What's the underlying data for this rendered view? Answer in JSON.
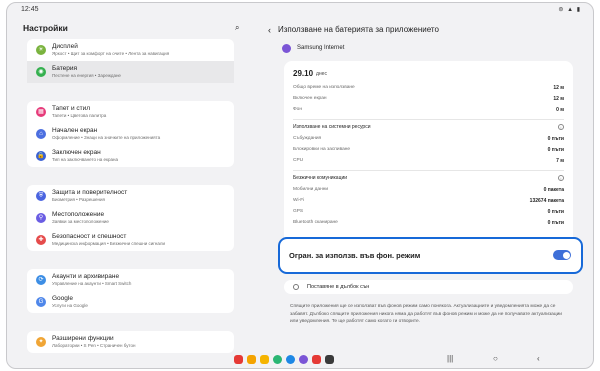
{
  "status": {
    "time": "12:45",
    "system_icons": "⊜ ▲ ▮"
  },
  "left": {
    "title": "Настройки",
    "search_icon": "⌕",
    "groups": [
      [
        {
          "title": "Дисплей",
          "subtitle": "Яркост • Щит за комфорт на очите • Лента за навигация",
          "color": "#7ab33e",
          "glyph": "☀"
        },
        {
          "title": "Батерия",
          "subtitle": "Пестене на енергия • Зареждане",
          "color": "#35b04f",
          "glyph": "◉",
          "selected": true
        }
      ],
      [
        {
          "title": "Тапет и стил",
          "subtitle": "Тапети • Цветова палитра",
          "color": "#e63b7a",
          "glyph": "▦"
        },
        {
          "title": "Начален екран",
          "subtitle": "Оформление • Знаци на значките на приложенията",
          "color": "#4c6fe0",
          "glyph": "⌂"
        },
        {
          "title": "Заключен екран",
          "subtitle": "Тип на заключването на екрана",
          "color": "#3a61d4",
          "glyph": "🔒"
        }
      ],
      [
        {
          "title": "Защита и поверителност",
          "subtitle": "Биометрия • Разрешения",
          "color": "#4a64e0",
          "glyph": "⛨"
        },
        {
          "title": "Местоположение",
          "subtitle": "Заявки за местоположение",
          "color": "#6a5de3",
          "glyph": "⚲"
        },
        {
          "title": "Безопасност и спешност",
          "subtitle": "Медицинска информация • Безжични спешни сигнали",
          "color": "#e54b4b",
          "glyph": "✚"
        }
      ],
      [
        {
          "title": "Акаунти и архивиране",
          "subtitle": "Управление на акаунти • Smart Switch",
          "color": "#3d8ee5",
          "glyph": "⟳"
        },
        {
          "title": "Google",
          "subtitle": "Услуги на Google",
          "color": "#4f87ea",
          "glyph": "G"
        }
      ],
      [
        {
          "title": "Разширени функции",
          "subtitle": "Лаборатории • S Pen • Страничен бутон",
          "color": "#f0a535",
          "glyph": "✦"
        }
      ]
    ]
  },
  "right": {
    "back_icon": "‹",
    "title": "Използване на батерията за приложението",
    "app_name": "Samsung Internet",
    "date": "29.10",
    "date_suffix": "днес",
    "usage_rows": [
      {
        "label": "Общо време на използване",
        "value": "12 м"
      },
      {
        "label": "Включен екран",
        "value": "12 м"
      },
      {
        "label": "Фон",
        "value": "0 м"
      }
    ],
    "system_section": "Използване на системни ресурси",
    "system_rows": [
      {
        "label": "Събуждания",
        "value": "0 пъти"
      },
      {
        "label": "Блокировки на заспиване",
        "value": "0 пъти"
      },
      {
        "label": "CPU",
        "value": "7 м"
      }
    ],
    "wireless_section": "Безжични комуникации",
    "wireless_rows": [
      {
        "label": "Мобилни данни",
        "value": "0 пакета"
      },
      {
        "label": "Wi-Fi",
        "value": "132674 пакета"
      },
      {
        "label": "GPS",
        "value": "0 пъти"
      },
      {
        "label": "Bluetooth сканиране",
        "value": "0 пъти"
      }
    ],
    "info_icon": "i",
    "restrict_label": "Огран. за използв. във фон. режим",
    "restrict_enabled": true,
    "deep_sleep_label": "Поставяне в дълбок сън",
    "description": "Спящите приложения ще се използват във фонов режим само понякога. Актуализациите и уведомленията може да се забавят. Дълбоко спящите приложения никога няма да работят във фонов режим и може да не получавате актуализации или уведомления. Те ще работят само когато ги отворите."
  },
  "nav": {
    "recents": "|||",
    "home": "○",
    "back": "‹"
  },
  "dock_colors": [
    "#e53935",
    "#f4a300",
    "#f5b400",
    "#2bb673",
    "#1e88e5",
    "#7b55d6",
    "#e53935",
    "#3a3a3a"
  ]
}
